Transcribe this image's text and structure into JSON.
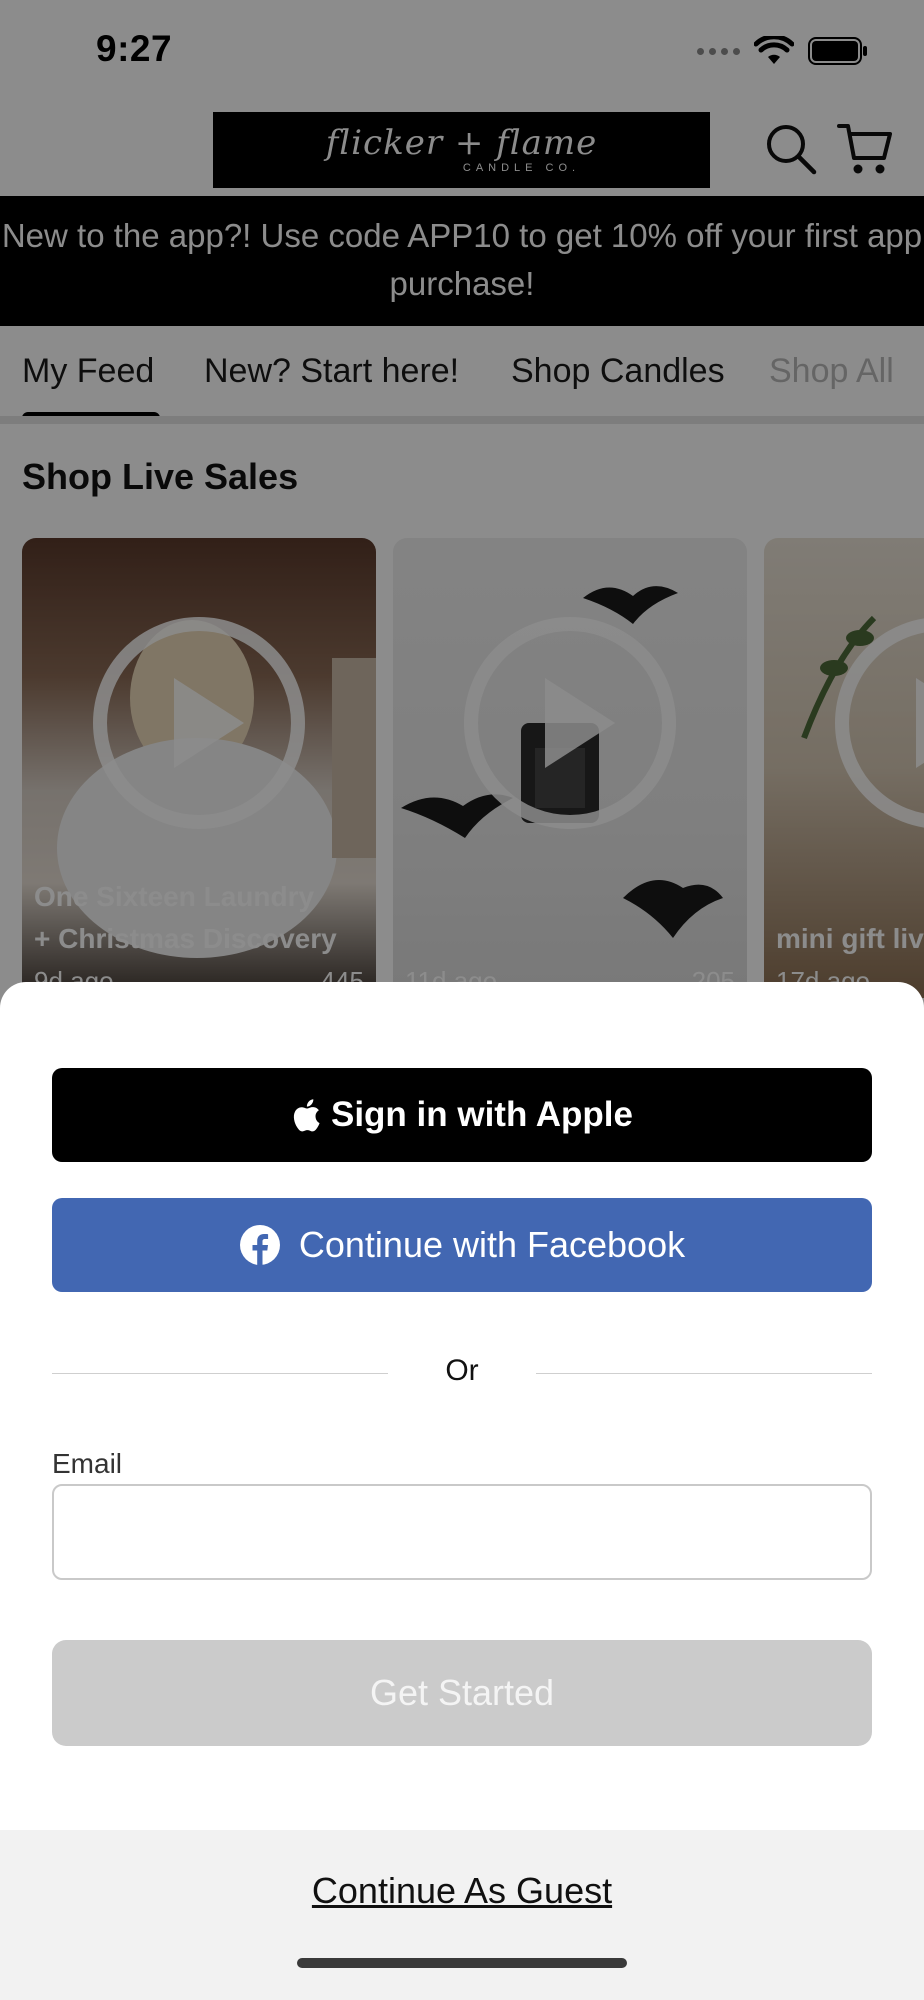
{
  "status_bar": {
    "time": "9:27"
  },
  "header": {
    "logo_script": "flicker + flame",
    "logo_sub": "CANDLE CO.",
    "search_icon": "search-icon",
    "cart_icon": "cart-icon"
  },
  "promo": {
    "text": "New to the app?! Use code APP10 to get 10% off your first app purchase!"
  },
  "tabs": [
    {
      "label": "My Feed",
      "selected": true
    },
    {
      "label": "New? Start here!"
    },
    {
      "label": "Shop Candles"
    },
    {
      "label": "Shop All"
    }
  ],
  "section": {
    "title": "Shop Live Sales"
  },
  "videos": [
    {
      "title_line1": "One Sixteen Laundry",
      "title_line2": "+ Christmas Discovery",
      "age": "9d ago",
      "views": "445"
    },
    {
      "title_line1": "",
      "title_line2": "",
      "age": "11d ago",
      "views": "205"
    },
    {
      "title_line1": "",
      "title_line2": "mini gift live",
      "age": "17d ago",
      "views": ""
    }
  ],
  "auth_sheet": {
    "apple_label": "Sign in with Apple",
    "facebook_label": "Continue with Facebook",
    "divider_label": "Or",
    "email_label": "Email",
    "email_value": "",
    "email_placeholder": "",
    "get_started_label": "Get Started",
    "guest_label": "Continue As Guest"
  },
  "colors": {
    "facebook_blue": "#4267b2",
    "disabled_gray": "#cbcbcb",
    "black": "#000000"
  }
}
